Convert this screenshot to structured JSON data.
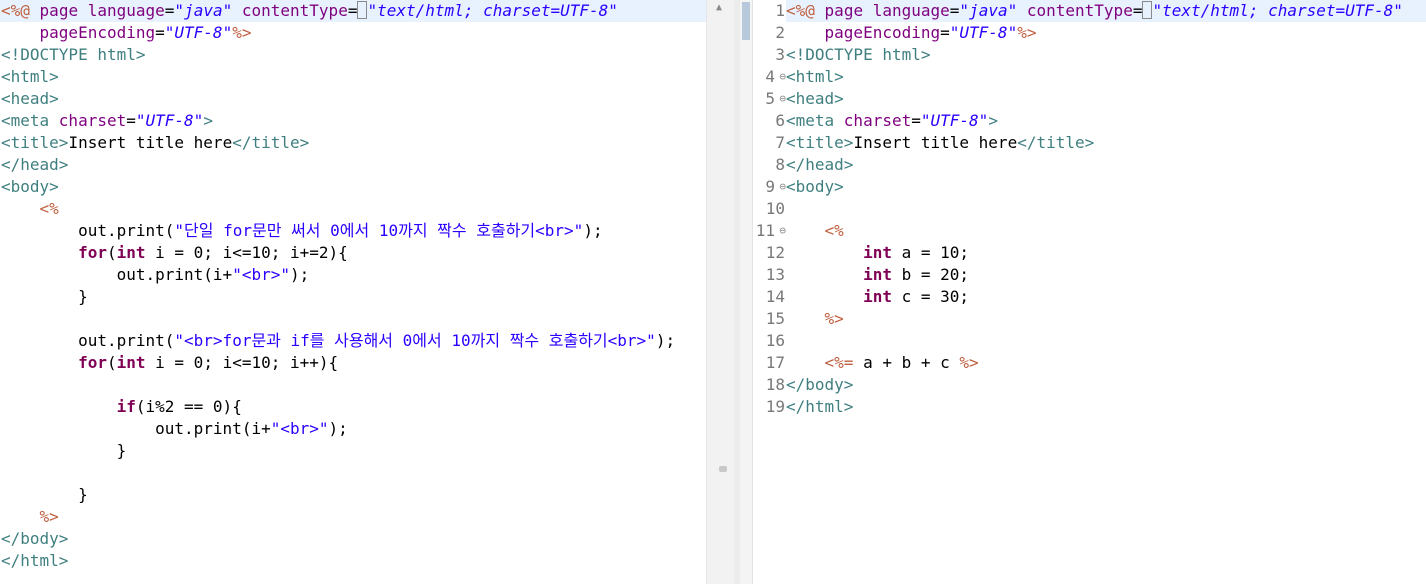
{
  "left": {
    "lines": [
      [
        [
          "jsp",
          "<%@"
        ],
        [
          "plain",
          " "
        ],
        [
          "attr",
          "page "
        ],
        [
          "attr",
          "language"
        ],
        [
          "plain",
          "="
        ],
        [
          "val",
          "\"java\""
        ],
        [
          "plain",
          " "
        ],
        [
          "attr",
          "contentType"
        ],
        [
          "plain",
          "="
        ],
        [
          "val",
          "\"text/html; charset=UTF-8\""
        ]
      ],
      [
        [
          "plain",
          "    "
        ],
        [
          "attr",
          "pageEncoding"
        ],
        [
          "plain",
          "="
        ],
        [
          "val",
          "\"UTF-8\""
        ],
        [
          "jsp",
          "%>"
        ]
      ],
      [
        [
          "tag",
          "<!DOCTYPE html>"
        ]
      ],
      [
        [
          "tag",
          "<html>"
        ]
      ],
      [
        [
          "tag",
          "<head>"
        ]
      ],
      [
        [
          "tag",
          "<meta "
        ],
        [
          "attr",
          "charset"
        ],
        [
          "plain",
          "="
        ],
        [
          "val",
          "\"UTF-8\""
        ],
        [
          "tag",
          ">"
        ]
      ],
      [
        [
          "tag",
          "<title>"
        ],
        [
          "plain",
          "Insert title here"
        ],
        [
          "tag",
          "</title>"
        ]
      ],
      [
        [
          "tag",
          "</head>"
        ]
      ],
      [
        [
          "tag",
          "<body>"
        ]
      ],
      [
        [
          "plain",
          "    "
        ],
        [
          "jsp",
          "<%"
        ]
      ],
      [
        [
          "plain",
          "        out.print("
        ],
        [
          "str",
          "\"단일 for문만 써서 0에서 10까지 짝수 호출하기<br>\""
        ],
        [
          "plain",
          ");"
        ]
      ],
      [
        [
          "plain",
          "        "
        ],
        [
          "kw",
          "for"
        ],
        [
          "plain",
          "("
        ],
        [
          "kw",
          "int"
        ],
        [
          "plain",
          " i = 0; i<=10; i+=2){"
        ]
      ],
      [
        [
          "plain",
          "            out.print(i+"
        ],
        [
          "str",
          "\"<br>\""
        ],
        [
          "plain",
          ");"
        ]
      ],
      [
        [
          "plain",
          "        }"
        ]
      ],
      [
        [
          "plain",
          ""
        ]
      ],
      [
        [
          "plain",
          "        out.print("
        ],
        [
          "str",
          "\"<br>for문과 if를 사용해서 0에서 10까지 짝수 호출하기<br>\""
        ],
        [
          "plain",
          ");"
        ]
      ],
      [
        [
          "plain",
          "        "
        ],
        [
          "kw",
          "for"
        ],
        [
          "plain",
          "("
        ],
        [
          "kw",
          "int"
        ],
        [
          "plain",
          " i = 0; i<=10; i++){"
        ]
      ],
      [
        [
          "plain",
          ""
        ]
      ],
      [
        [
          "plain",
          "            "
        ],
        [
          "kw",
          "if"
        ],
        [
          "plain",
          "(i%2 == 0){"
        ]
      ],
      [
        [
          "plain",
          "                out.print(i+"
        ],
        [
          "str",
          "\"<br>\""
        ],
        [
          "plain",
          ");"
        ]
      ],
      [
        [
          "plain",
          "            }"
        ]
      ],
      [
        [
          "plain",
          ""
        ]
      ],
      [
        [
          "plain",
          "        }"
        ]
      ],
      [
        [
          "plain",
          "    "
        ],
        [
          "jsp",
          "%>"
        ]
      ],
      [
        [
          "tag",
          "</body>"
        ]
      ],
      [
        [
          "tag",
          "</html>"
        ]
      ]
    ]
  },
  "right": {
    "line_numbers": [
      "1",
      "2",
      "3",
      "4",
      "5",
      "6",
      "7",
      "8",
      "9",
      "10",
      "11",
      "12",
      "13",
      "14",
      "15",
      "16",
      "17",
      "18",
      "19"
    ],
    "fold_lines": [
      4,
      5,
      9,
      11
    ],
    "lines": [
      [
        [
          "jsp",
          "<%@"
        ],
        [
          "plain",
          " "
        ],
        [
          "attr",
          "page "
        ],
        [
          "attr",
          "language"
        ],
        [
          "plain",
          "="
        ],
        [
          "val",
          "\"java\""
        ],
        [
          "plain",
          " "
        ],
        [
          "attr",
          "contentType"
        ],
        [
          "plain",
          "="
        ],
        [
          "val",
          "\"text/html; charset=UTF-8\""
        ]
      ],
      [
        [
          "plain",
          "    "
        ],
        [
          "attr",
          "pageEncoding"
        ],
        [
          "plain",
          "="
        ],
        [
          "val",
          "\"UTF-8\""
        ],
        [
          "jsp",
          "%>"
        ]
      ],
      [
        [
          "tag",
          "<!DOCTYPE html>"
        ]
      ],
      [
        [
          "tag",
          "<html>"
        ]
      ],
      [
        [
          "tag",
          "<head>"
        ]
      ],
      [
        [
          "tag",
          "<meta "
        ],
        [
          "attr",
          "charset"
        ],
        [
          "plain",
          "="
        ],
        [
          "val",
          "\"UTF-8\""
        ],
        [
          "tag",
          ">"
        ]
      ],
      [
        [
          "tag",
          "<title>"
        ],
        [
          "plain",
          "Insert title here"
        ],
        [
          "tag",
          "</title>"
        ]
      ],
      [
        [
          "tag",
          "</head>"
        ]
      ],
      [
        [
          "tag",
          "<body>"
        ]
      ],
      [
        [
          "plain",
          ""
        ]
      ],
      [
        [
          "plain",
          "    "
        ],
        [
          "jsp",
          "<%"
        ]
      ],
      [
        [
          "plain",
          "        "
        ],
        [
          "kw",
          "int"
        ],
        [
          "plain",
          " a = 10;"
        ]
      ],
      [
        [
          "plain",
          "        "
        ],
        [
          "kw",
          "int"
        ],
        [
          "plain",
          " b = 20;"
        ]
      ],
      [
        [
          "plain",
          "        "
        ],
        [
          "kw",
          "int"
        ],
        [
          "plain",
          " c = 30;"
        ]
      ],
      [
        [
          "plain",
          "    "
        ],
        [
          "jsp",
          "%>"
        ]
      ],
      [
        [
          "plain",
          ""
        ]
      ],
      [
        [
          "plain",
          "    "
        ],
        [
          "jsp",
          "<%="
        ],
        [
          "plain",
          " a + b + c "
        ],
        [
          "jsp",
          "%>"
        ]
      ],
      [
        [
          "tag",
          "</body>"
        ]
      ],
      [
        [
          "tag",
          "</html>"
        ]
      ]
    ]
  },
  "icons": {
    "fold_marker": "minus-circle-icon",
    "scroll_up": "caret-up-icon"
  }
}
